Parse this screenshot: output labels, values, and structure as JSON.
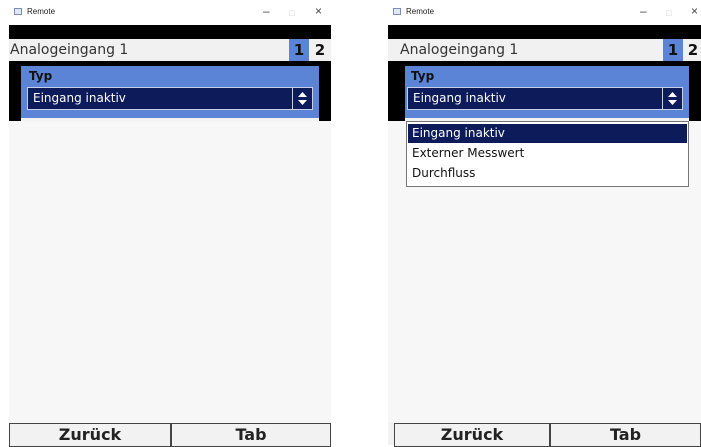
{
  "left_window": {
    "title": "Remote",
    "page_title": "Analogeingang 1",
    "pages": [
      "1",
      "2"
    ],
    "field_label": "Typ",
    "selected_value": "Eingang inaktiv",
    "buttons": {
      "back": "Zurück",
      "tab": "Tab"
    }
  },
  "right_window": {
    "title": "Remote",
    "page_title": "Analogeingang 1",
    "pages": [
      "1",
      "2"
    ],
    "field_label": "Typ",
    "selected_value": "Eingang inaktiv",
    "options": [
      "Eingang inaktiv",
      "Externer Messwert",
      "Durchfluss"
    ],
    "buttons": {
      "back": "Zurück",
      "tab": "Tab"
    }
  },
  "window_controls": {
    "minimize": "–",
    "maximize": "□",
    "close": "×"
  },
  "colors": {
    "accent": "#5b84d6",
    "selected": "#0d1b5a",
    "background": "#000000"
  }
}
